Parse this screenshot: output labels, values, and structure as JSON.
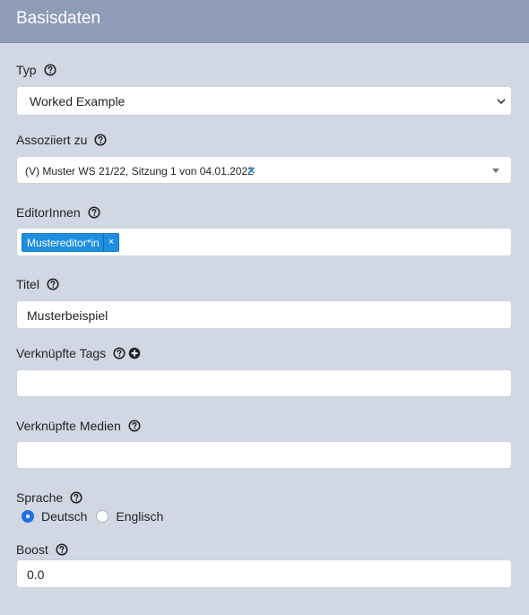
{
  "header": {
    "title": "Basisdaten"
  },
  "typ": {
    "label": "Typ",
    "value": "Worked Example"
  },
  "assoziiert": {
    "label": "Assoziiert zu",
    "value": "(V) Muster WS 21/22, Sitzung 1 von 04.01.2022",
    "clear": "×"
  },
  "editoren": {
    "label": "EditorInnen",
    "tags": [
      "Mustereditor*in"
    ],
    "remove": "×"
  },
  "titel": {
    "label": "Titel",
    "value": "Musterbeispiel"
  },
  "tags": {
    "label": "Verknüpfte Tags",
    "value": ""
  },
  "medien": {
    "label": "Verknüpfte Medien",
    "value": ""
  },
  "sprache": {
    "label": "Sprache",
    "options": [
      "Deutsch",
      "Englisch"
    ],
    "selected": "Deutsch"
  },
  "boost": {
    "label": "Boost",
    "value": "0.0"
  },
  "colors": {
    "header_bg": "#8e9cb8",
    "page_bg": "#d1d7e3",
    "accent": "#1d6fe8",
    "tag_bg": "#1d8fe0"
  }
}
